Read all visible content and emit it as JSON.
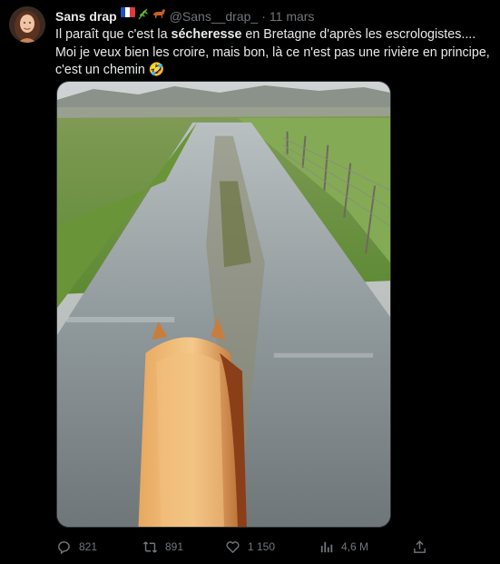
{
  "tweet": {
    "author_name": "Sans drap",
    "handle": "@Sans__drap_",
    "separator": "·",
    "date": "11 mars",
    "text_before": "Il paraît que c'est la ",
    "text_bold": "sécheresse",
    "text_after": " en Bretagne d'après les escrologistes.... Moi je veux bien les croire, mais bon, là ce n'est pas une rivière en principe, c'est un chemin",
    "emoji_end": "🤣",
    "name_emojis": [
      "flag-france-icon",
      "herb-icon",
      "horse-icon"
    ]
  },
  "actions": {
    "replies": "821",
    "retweets": "891",
    "likes": "1 150",
    "views": "4,6 M"
  },
  "colors": {
    "background": "#000000",
    "text": "#e7e9ea",
    "muted": "#71767b",
    "border": "#2f3336"
  }
}
